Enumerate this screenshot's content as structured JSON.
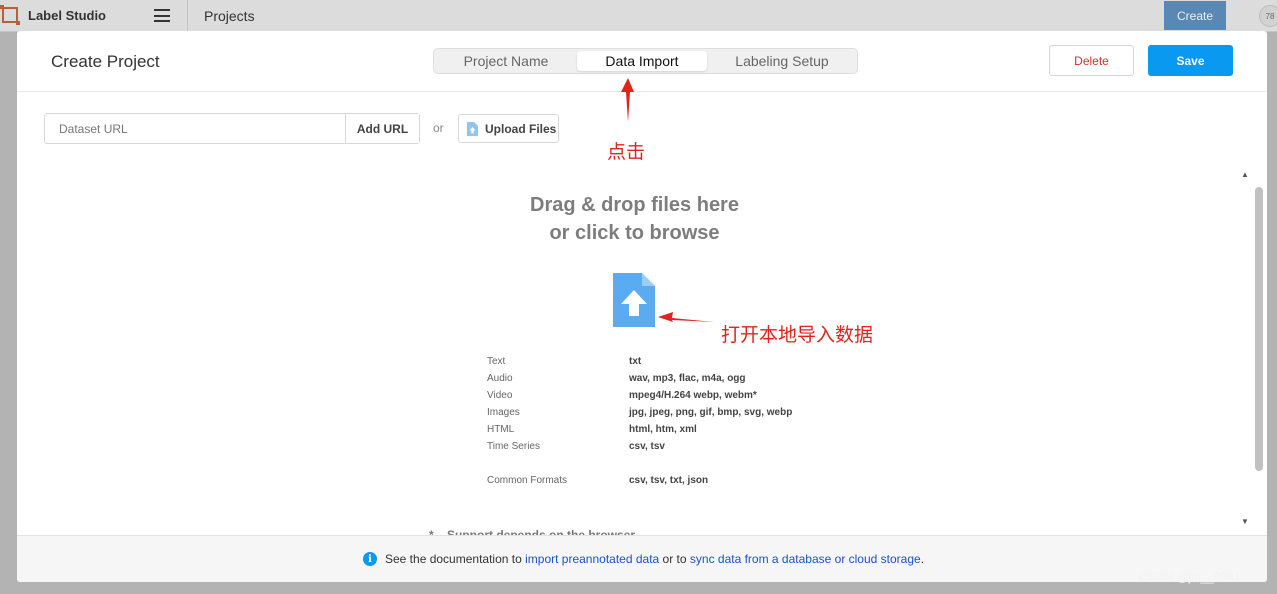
{
  "app": {
    "name": "Label Studio",
    "breadcrumb": "Projects",
    "create_label": "Create",
    "avatar_text": "78"
  },
  "modal": {
    "title": "Create Project",
    "tabs": [
      {
        "label": "Project Name",
        "active": false
      },
      {
        "label": "Data Import",
        "active": true
      },
      {
        "label": "Labeling Setup",
        "active": false
      }
    ],
    "delete_label": "Delete",
    "save_label": "Save"
  },
  "import": {
    "url_placeholder": "Dataset URL",
    "add_url_label": "Add URL",
    "or_text": "or",
    "upload_label": "Upload Files"
  },
  "dropzone": {
    "line1": "Drag & drop files here",
    "line2": "or click to browse"
  },
  "formats": [
    {
      "type": "Text",
      "ext": "txt"
    },
    {
      "type": "Audio",
      "ext": "wav, mp3, flac, m4a, ogg"
    },
    {
      "type": "Video",
      "ext": "mpeg4/H.264 webp, webm*"
    },
    {
      "type": "Images",
      "ext": "jpg, jpeg, png, gif, bmp, svg, webp"
    },
    {
      "type": "HTML",
      "ext": "html, htm, xml"
    },
    {
      "type": "Time Series",
      "ext": "csv, tsv"
    },
    {
      "type": "Common Formats",
      "ext": "csv, tsv, txt, json"
    }
  ],
  "support_note": "* – Support depends on the browser",
  "footer": {
    "prefix": "See the documentation to ",
    "link1": "import preannotated data",
    "middle": " or to ",
    "link2": "sync data from a database or cloud storage",
    "suffix": "."
  },
  "annotations": {
    "click_hint": "点击",
    "open_hint": "打开本地导入数据",
    "color": "#e2231a"
  },
  "watermark": "CSDN @jin__9981",
  "colors": {
    "primary": "#0a99f0",
    "danger": "#d4302c",
    "link": "#1a52c7"
  }
}
